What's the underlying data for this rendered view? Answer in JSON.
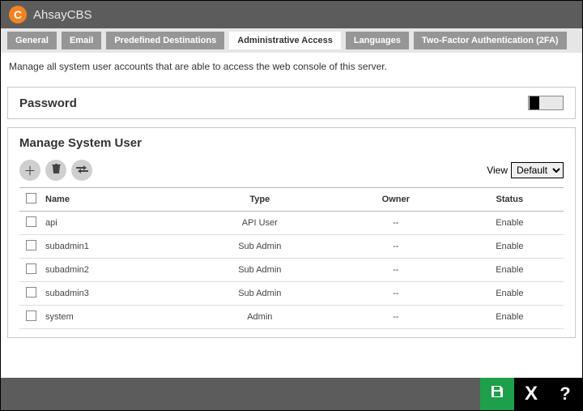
{
  "header": {
    "logo": "C",
    "title": "AhsayCBS"
  },
  "tabs": [
    {
      "label": "General",
      "active": false
    },
    {
      "label": "Email",
      "active": false
    },
    {
      "label": "Predefined Destinations",
      "active": false
    },
    {
      "label": "Administrative Access",
      "active": true
    },
    {
      "label": "Languages",
      "active": false
    },
    {
      "label": "Two-Factor Authentication (2FA)",
      "active": false
    }
  ],
  "description": "Manage all system user accounts that are able to access the web console of this server.",
  "password_section": {
    "label": "Password"
  },
  "manage_section": {
    "title": "Manage System User",
    "view_label": "View",
    "view_value": "Default",
    "columns": {
      "name": "Name",
      "type": "Type",
      "owner": "Owner",
      "status": "Status"
    },
    "rows": [
      {
        "name": "api",
        "type": "API User",
        "owner": "--",
        "status": "Enable"
      },
      {
        "name": "subadmin1",
        "type": "Sub Admin",
        "owner": "--",
        "status": "Enable"
      },
      {
        "name": "subadmin2",
        "type": "Sub Admin",
        "owner": "--",
        "status": "Enable"
      },
      {
        "name": "subadmin3",
        "type": "Sub Admin",
        "owner": "--",
        "status": "Enable"
      },
      {
        "name": "system",
        "type": "Admin",
        "owner": "--",
        "status": "Enable"
      }
    ]
  },
  "footer": {
    "close": "X",
    "help": "?"
  }
}
